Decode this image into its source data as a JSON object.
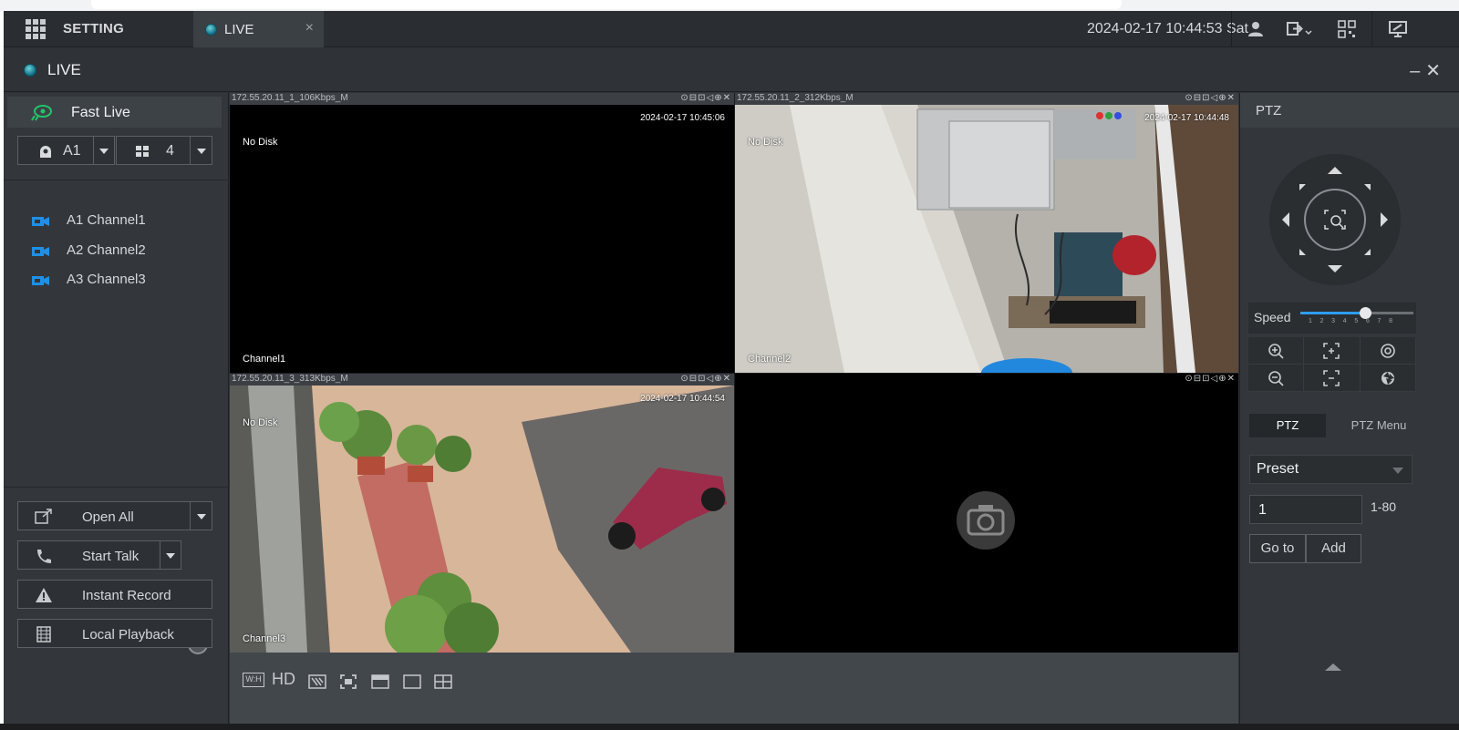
{
  "topbar": {
    "setting_label": "SETTING",
    "live_tab_label": "LIVE",
    "tab_close": "×",
    "datetime": "2024-02-17 10:44:53 Sat",
    "icons": [
      "user-icon",
      "logout-icon",
      "qr-code-icon",
      "monitor-icon"
    ]
  },
  "titlebar": {
    "title": "LIVE",
    "controls": "–✕"
  },
  "sidebar": {
    "fast_live_label": "Fast Live",
    "device_select": "A1",
    "layout_select": "4",
    "channels": [
      {
        "label": "A1 Channel1"
      },
      {
        "label": "A2 Channel2"
      },
      {
        "label": "A3 Channel3"
      }
    ],
    "buttons": {
      "open_all": "Open All",
      "start_talk": "Start Talk",
      "instant_record": "Instant Record",
      "local_playback": "Local Playback"
    }
  },
  "video": {
    "cells": [
      {
        "source": "172.55.20.11_1_106Kbps_M",
        "no_disk": "No Disk",
        "timestamp": "2024-02-17 10:45:06",
        "channel": "Channel1",
        "active": true
      },
      {
        "source": "172.55.20.11_2_312Kbps_M",
        "no_disk": "No Disk",
        "timestamp": "2024-02-17 10:44:48",
        "channel": "Channel2",
        "active": false
      },
      {
        "source": "172.55.20.11_3_313Kbps_M",
        "no_disk": "No Disk",
        "timestamp": "2024-02-17 10:44:54",
        "channel": "Channel3",
        "active": false
      },
      {
        "source": "",
        "no_disk": "",
        "timestamp": "",
        "channel": "",
        "active": false
      }
    ],
    "cell_tools": "⊙⊟⊡◁⊕✕",
    "toolbar": {
      "hd_label": "HD",
      "wh_label": "W:H",
      "icons": [
        "aspect-ratio-icon",
        "hd-icon",
        "dewarp-icon",
        "fullscreen-icon",
        "window-split-1-icon",
        "window-single-icon",
        "window-split-4-icon"
      ]
    }
  },
  "ptz": {
    "title": "PTZ",
    "speed_label": "Speed",
    "speed_value": 5,
    "speed_ticks": "12345678",
    "tabs": [
      "PTZ",
      "PTZ Menu"
    ],
    "preset_label": "Preset",
    "preset_value": "1",
    "preset_range": "1-80",
    "goto_label": "Go to",
    "add_label": "Add"
  },
  "colors": {
    "active_border": "#39c739",
    "accent": "#2f9df0",
    "channel_icon": "#1e90e6",
    "fast_live_icon": "#23c46a"
  }
}
